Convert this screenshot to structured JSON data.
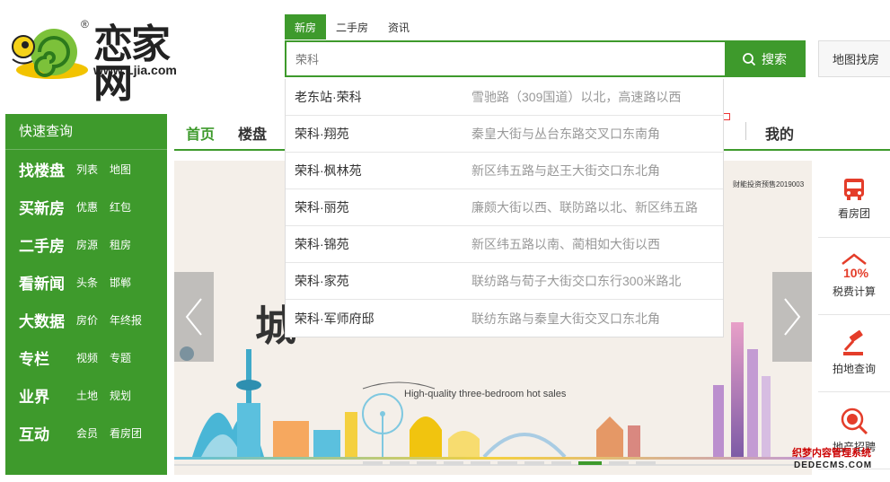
{
  "logo": {
    "brand": "恋家网",
    "url": "www.Ljia.com",
    "reg": "®"
  },
  "search": {
    "tabs": [
      "新房",
      "二手房",
      "资讯"
    ],
    "value": "荣科",
    "button": "搜索",
    "map_button": "地图找房"
  },
  "suggestions": [
    {
      "name": "老东站·荣科",
      "addr": "雪驰路（309国道）以北，高速路以西"
    },
    {
      "name": "荣科·翔苑",
      "addr": "秦皇大街与丛台东路交叉口东南角"
    },
    {
      "name": "荣科·枫林苑",
      "addr": "新区纬五路与赵王大街交口东北角"
    },
    {
      "name": "荣科·丽苑",
      "addr": "廉颇大街以西、联防路以北、新区纬五路"
    },
    {
      "name": "荣科·锦苑",
      "addr": "新区纬五路以南、蔺相如大街以西"
    },
    {
      "name": "荣科·家苑",
      "addr": "联纺路与荀子大街交口东行300米路北"
    },
    {
      "name": "荣科·军师府邸",
      "addr": "联纺东路与秦皇大街交叉口东北角"
    }
  ],
  "quick_menu": {
    "title": "快速查询",
    "rows": [
      {
        "head": "找楼盘",
        "subs": [
          "列表",
          "地图"
        ]
      },
      {
        "head": "买新房",
        "subs": [
          "优惠",
          "红包"
        ]
      },
      {
        "head": "二手房",
        "subs": [
          "房源",
          "租房"
        ]
      },
      {
        "head": "看新闻",
        "subs": [
          "头条",
          "邯郸"
        ]
      },
      {
        "head": "大数据",
        "subs": [
          "房价",
          "年终报"
        ]
      },
      {
        "head": "专栏",
        "subs": [
          "视频",
          "专题"
        ]
      },
      {
        "head": "业界",
        "subs": [
          "土地",
          "规划"
        ]
      },
      {
        "head": "互动",
        "subs": [
          "会员",
          "看房团"
        ]
      }
    ]
  },
  "nav": {
    "home": "首页",
    "loupan": "楼盘",
    "mine": "我的"
  },
  "banner": {
    "big_text": "城",
    "caption": "High-quality three-bedroom hot sales",
    "tag": "财能投资预售2019003"
  },
  "tools": [
    "看房团",
    "税费计算",
    "拍地查询",
    "地产招聘"
  ],
  "tool_icon_text": "10%",
  "watermark": {
    "line1": "织梦内容管理系统",
    "line2": "DEDECMS.COM"
  },
  "colors": {
    "green": "#3e9a2c",
    "red": "#e43d2a"
  }
}
